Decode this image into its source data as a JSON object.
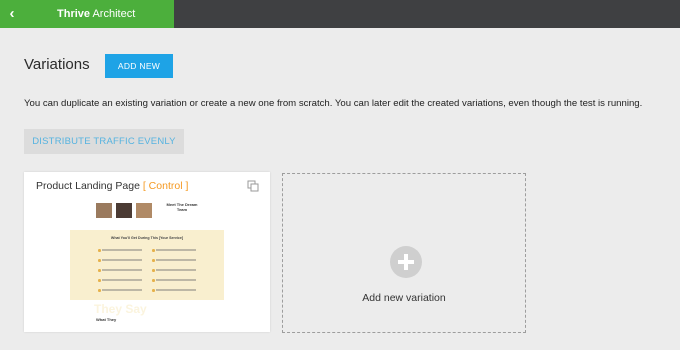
{
  "header": {
    "back_icon": "chevron-left-icon",
    "brand_bold": "Thrive",
    "brand_rest": "Architect",
    "brand_color": "#4caf3c",
    "bar_color": "#3f4042"
  },
  "variations": {
    "title": "Variations",
    "add_new_label": "ADD NEW",
    "description": "You can duplicate an existing variation or create a new one from scratch. You can later edit the created variations, even though the test is running.",
    "distribute_label": "DISTRIBUTE TRAFFIC EVENLY",
    "accent_color": "#1ea3e6"
  },
  "cards": [
    {
      "name": "Product Landing Page",
      "badge": "[ Control ]",
      "copy_icon": "duplicate-icon",
      "preview": {
        "heading": "Meet The Dream Team",
        "box_title": "What You'll Get During This [Your Service]",
        "big_text": "They Say",
        "small_text": "What They"
      }
    }
  ],
  "add_variation": {
    "icon": "plus-circle-icon",
    "label": "Add new variation"
  }
}
